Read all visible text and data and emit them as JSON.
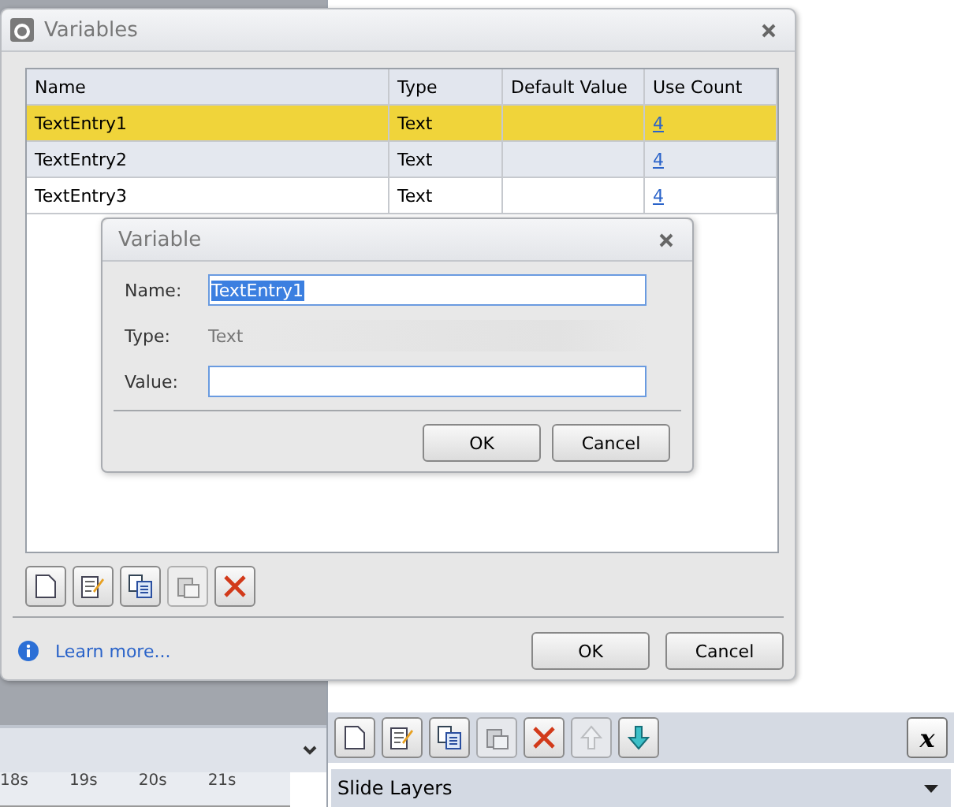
{
  "background": {
    "timeline": {
      "ticks": [
        "18s",
        "19s",
        "20s",
        "21s"
      ]
    },
    "toolbar": [
      {
        "kind": "new",
        "disabled": false
      },
      {
        "kind": "edit",
        "disabled": false
      },
      {
        "kind": "copy",
        "disabled": false
      },
      {
        "kind": "paste",
        "disabled": true
      },
      {
        "kind": "delete",
        "disabled": false
      },
      {
        "kind": "up",
        "disabled": true
      },
      {
        "kind": "down",
        "disabled": false
      }
    ],
    "variables_button": "x",
    "slide_layers": "Slide Layers"
  },
  "variables_dialog": {
    "title": "Variables",
    "table": {
      "columns": [
        "Name",
        "Type",
        "Default Value",
        "Use Count"
      ],
      "rows": [
        {
          "name": "TextEntry1",
          "type": "Text",
          "use_count": "4",
          "selected": true
        },
        {
          "name": "TextEntry2",
          "type": "Text",
          "use_count": "4",
          "selected": false
        },
        {
          "name": "TextEntry3",
          "type": "Text",
          "use_count": "4",
          "selected": false
        }
      ]
    },
    "toolbar": [
      {
        "kind": "new",
        "disabled": false
      },
      {
        "kind": "edit",
        "disabled": false
      },
      {
        "kind": "copy",
        "disabled": false
      },
      {
        "kind": "paste",
        "disabled": true
      },
      {
        "kind": "delete",
        "disabled": false
      }
    ],
    "learn_more": "Learn more...",
    "buttons": [
      "OK",
      "Cancel"
    ]
  },
  "variable_dialog": {
    "title": "Variable",
    "fields": [
      {
        "kind": "input",
        "label": "Name:",
        "value": "TextEntry1",
        "selected": true
      },
      {
        "kind": "static",
        "label": "Type:",
        "value": "Text"
      },
      {
        "kind": "input",
        "label": "Value:"
      }
    ],
    "buttons": [
      "OK",
      "Cancel"
    ]
  }
}
